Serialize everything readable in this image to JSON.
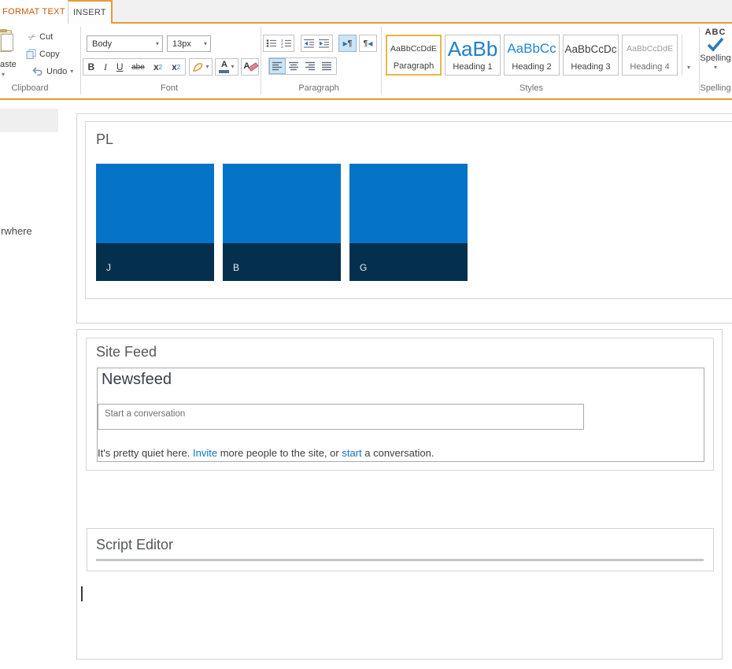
{
  "tabs": {
    "format_text": "FORMAT TEXT",
    "insert": "INSERT"
  },
  "ribbon": {
    "clipboard": {
      "group_label": "Clipboard",
      "paste_label": "aste",
      "cut": "Cut",
      "copy": "Copy",
      "undo": "Undo"
    },
    "font": {
      "group_label": "Font",
      "family": "Body",
      "size": "13px",
      "bold": "B",
      "italic": "I",
      "underline": "U",
      "strikethrough": "abe",
      "sub_base": "x",
      "sub_mark": "2",
      "sup_base": "x",
      "sup_mark": "2",
      "color_letter": "A",
      "clear_letter": "A"
    },
    "paragraph": {
      "group_label": "Paragraph"
    },
    "styles": {
      "group_label": "Styles",
      "items": [
        {
          "preview": "AaBbCcDdE",
          "label": "Paragraph"
        },
        {
          "preview": "AaBb",
          "label": "Heading 1"
        },
        {
          "preview": "AaBbCc",
          "label": "Heading 2"
        },
        {
          "preview": "AaBbCcDc",
          "label": "Heading 3"
        },
        {
          "preview": "AaBbCcDdE",
          "label": "Heading 4"
        }
      ]
    },
    "spelling": {
      "group_label": "Spelling",
      "abc": "ABC",
      "button_label": "Spelling"
    }
  },
  "left_nav": {
    "fragment": "rwhere"
  },
  "content": {
    "tiles": {
      "title": "PL",
      "blue": "#0473c8",
      "dark": "#05304d",
      "items": [
        {
          "label": "J"
        },
        {
          "label": "B"
        },
        {
          "label": "G"
        }
      ]
    },
    "site_feed": {
      "title": "Site Feed",
      "newsfeed_title": "Newsfeed",
      "input_placeholder": "Start a conversation",
      "quiet_prefix": "It's pretty quiet here. ",
      "invite_link": "Invite",
      "quiet_middle": " more people to the site, or ",
      "start_link": "start",
      "quiet_suffix": " a conversation."
    },
    "script_editor": {
      "title": "Script Editor"
    }
  }
}
